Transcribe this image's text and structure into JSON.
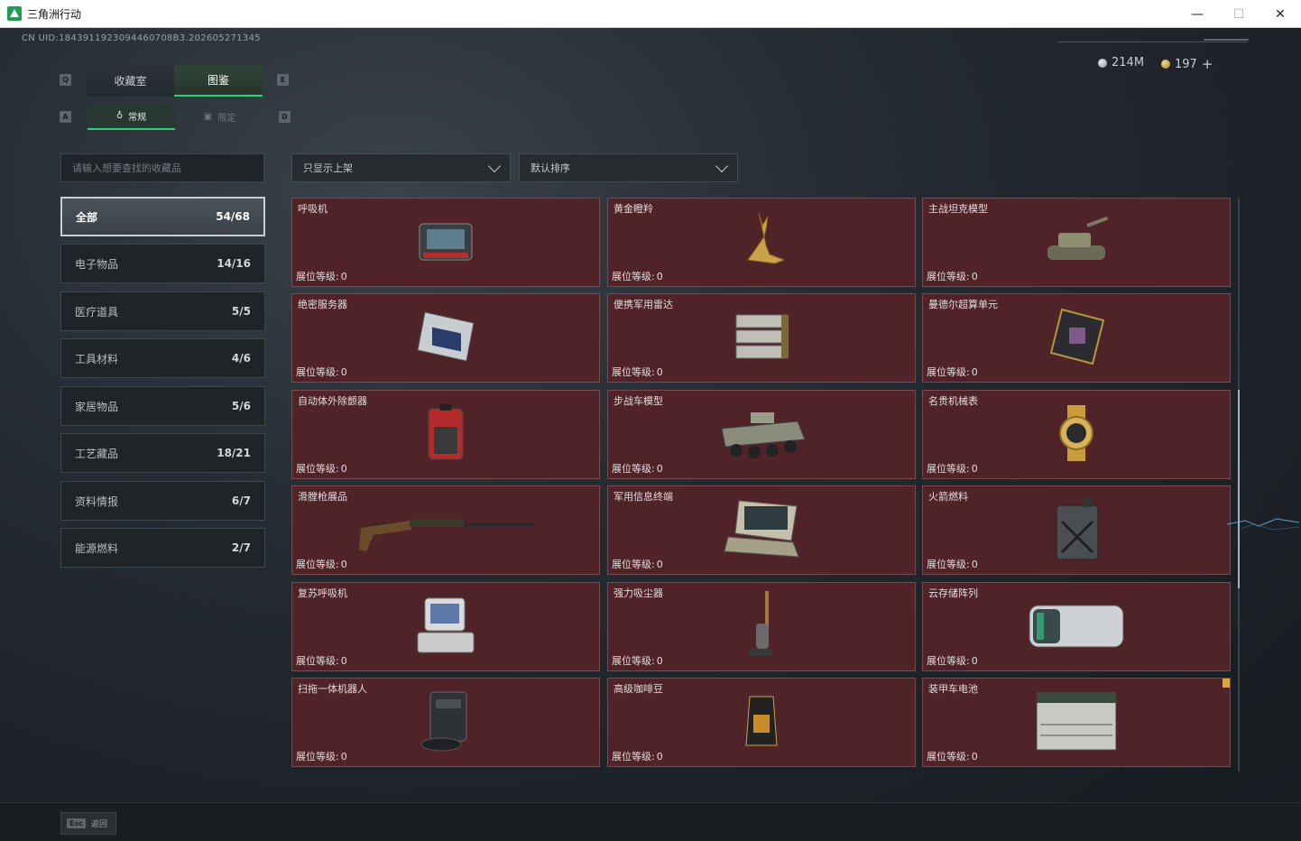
{
  "window": {
    "title": "三角洲行动",
    "minimize": "—",
    "maximize": "☐",
    "close": "✕"
  },
  "header": {
    "uid": "CN UID:1843911923094460708B3.202605271345",
    "currency_silver": "214M",
    "currency_gold": "197",
    "currency_add": "+"
  },
  "keys": {
    "tab_left": "Q",
    "tab_right": "E",
    "sub_left": "A",
    "sub_right": "D"
  },
  "tabs": {
    "collection": "收藏室",
    "atlas": "图鉴"
  },
  "subtabs": {
    "normal": "常规",
    "limited": "限定"
  },
  "search": {
    "placeholder": "请输入想要查找的收藏品"
  },
  "categories": [
    {
      "label": "全部",
      "count": "54/68"
    },
    {
      "label": "电子物品",
      "count": "14/16"
    },
    {
      "label": "医疗道具",
      "count": "5/5"
    },
    {
      "label": "工具材料",
      "count": "4/6"
    },
    {
      "label": "家居物品",
      "count": "5/6"
    },
    {
      "label": "工艺藏品",
      "count": "18/21"
    },
    {
      "label": "资料情报",
      "count": "6/7"
    },
    {
      "label": "能源燃料",
      "count": "2/7"
    }
  ],
  "filters": {
    "shelf": "只显示上架",
    "sort": "默认排序"
  },
  "level_label": "展位等级:",
  "items": [
    {
      "name": "呼吸机",
      "level": "0",
      "icon": "ventilator-icon"
    },
    {
      "name": "黄金瞪羚",
      "level": "0",
      "icon": "golden-gazelle-icon"
    },
    {
      "name": "主战坦克模型",
      "level": "0",
      "icon": "tank-model-icon"
    },
    {
      "name": "绝密服务器",
      "level": "0",
      "icon": "server-icon"
    },
    {
      "name": "便携军用雷达",
      "level": "0",
      "icon": "radar-icon"
    },
    {
      "name": "曼德尔超算单元",
      "level": "0",
      "icon": "supercomputer-unit-icon"
    },
    {
      "name": "自动体外除颤器",
      "level": "0",
      "icon": "defibrillator-icon"
    },
    {
      "name": "步战车模型",
      "level": "0",
      "icon": "ifv-model-icon"
    },
    {
      "name": "名贵机械表",
      "level": "0",
      "icon": "watch-icon"
    },
    {
      "name": "滑膛枪展品",
      "level": "0",
      "icon": "musket-icon"
    },
    {
      "name": "军用信息终端",
      "level": "0",
      "icon": "military-terminal-icon"
    },
    {
      "name": "火箭燃料",
      "level": "0",
      "icon": "fuel-can-icon"
    },
    {
      "name": "复苏呼吸机",
      "level": "0",
      "icon": "resuscitator-icon"
    },
    {
      "name": "强力吸尘器",
      "level": "0",
      "icon": "vacuum-icon"
    },
    {
      "name": "云存储阵列",
      "level": "0",
      "icon": "storage-array-icon"
    },
    {
      "name": "扫拖一体机器人",
      "level": "0",
      "icon": "robot-vacuum-icon"
    },
    {
      "name": "高级咖啡豆",
      "level": "0",
      "icon": "coffee-beans-icon"
    },
    {
      "name": "装甲车电池",
      "level": "0",
      "icon": "battery-icon"
    }
  ],
  "footer": {
    "esc_key": "Esc",
    "back": "返回"
  }
}
